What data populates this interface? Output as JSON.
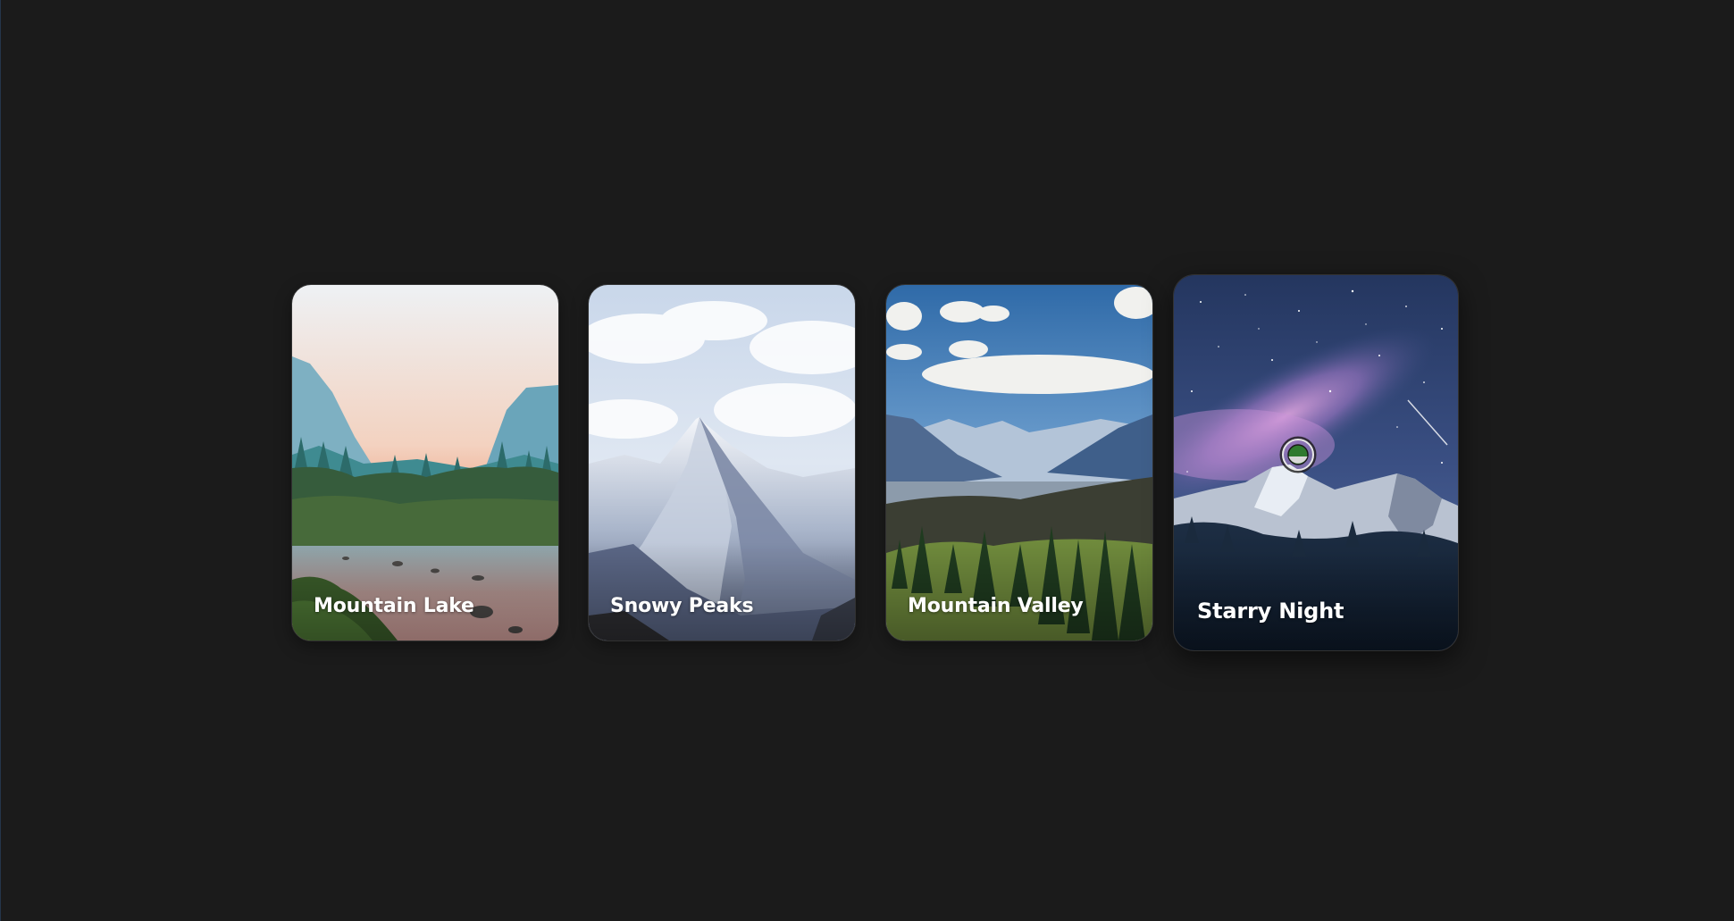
{
  "gallery": {
    "cards": [
      {
        "title": "Mountain Lake"
      },
      {
        "title": "Snowy Peaks"
      },
      {
        "title": "Mountain Valley"
      },
      {
        "title": "Starry Night"
      }
    ]
  },
  "colors": {
    "background": "#1b1b1b",
    "caption_text": "#ffffff",
    "cursor_green": "#2f7a2f"
  },
  "cursor": {
    "icon": "cursor-ring-icon"
  }
}
